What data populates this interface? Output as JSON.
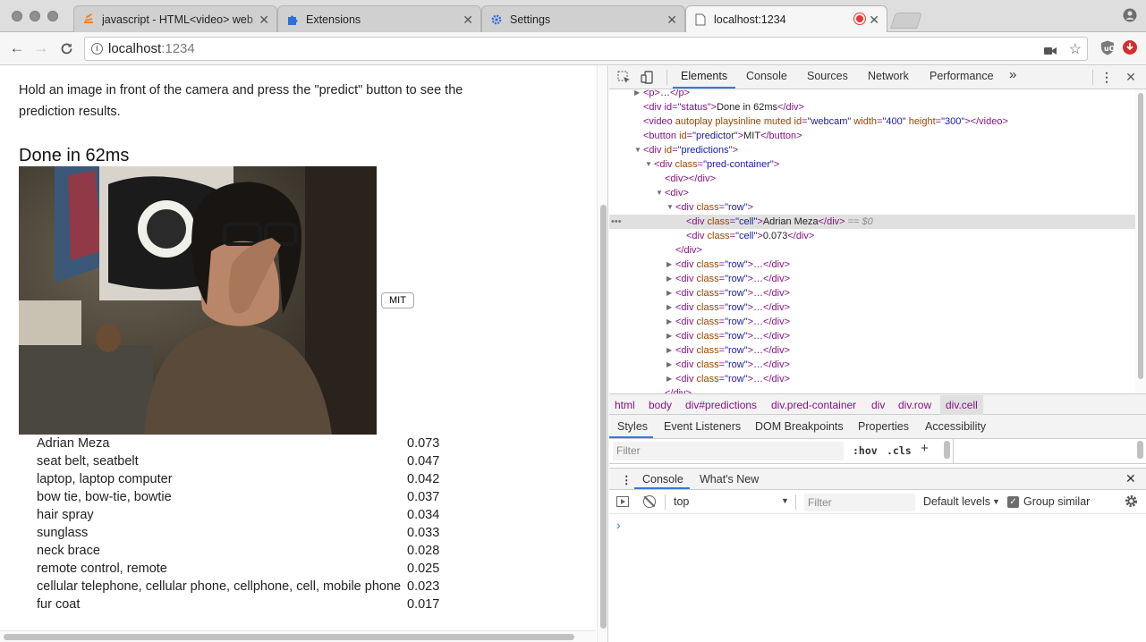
{
  "browser": {
    "tabs": [
      {
        "title": "javascript - HTML<video> web",
        "icon": "stackoverflow-icon",
        "active": false
      },
      {
        "title": "Extensions",
        "icon": "puzzle-icon",
        "active": false
      },
      {
        "title": "Settings",
        "icon": "gear-icon",
        "active": false
      },
      {
        "title": "localhost:1234",
        "icon": "page-icon",
        "active": true
      }
    ],
    "url_host": "localhost",
    "url_port": ":1234",
    "colors": {
      "tab_strip": "#dedede",
      "toolbar": "#f6f6f6",
      "accent": "#3879d9",
      "record": "#e53935"
    }
  },
  "page": {
    "intro": "Hold an image in front of the camera and press the \"predict\" button to see the prediction results.",
    "status": "Done in 62ms",
    "predict_button": "MIT",
    "predictions": [
      {
        "label": "Adrian Meza",
        "value": "0.073"
      },
      {
        "label": "seat belt, seatbelt",
        "value": "0.047"
      },
      {
        "label": "laptop, laptop computer",
        "value": "0.042"
      },
      {
        "label": "bow tie, bow-tie, bowtie",
        "value": "0.037"
      },
      {
        "label": "hair spray",
        "value": "0.034"
      },
      {
        "label": "sunglass",
        "value": "0.033"
      },
      {
        "label": "neck brace",
        "value": "0.028"
      },
      {
        "label": "remote control, remote",
        "value": "0.025"
      },
      {
        "label": "cellular telephone, cellular phone, cellphone, cell, mobile phone",
        "value": "0.023"
      },
      {
        "label": "fur coat",
        "value": "0.017"
      }
    ]
  },
  "devtools": {
    "tabs": [
      "Elements",
      "Console",
      "Sources",
      "Network",
      "Performance"
    ],
    "more": "»",
    "dom": {
      "p_open": "<p>",
      "p_ellipsis": "…",
      "p_close": "</p>",
      "status_open": "<div id=\"status\">",
      "status_text": "Done in 62ms",
      "status_close": "</div>",
      "video_line": "<video autoplay playsinline muted id=\"webcam\" width=\"400\" height=\"300\"></video>",
      "video_tag": "<video",
      "video_attrs": " autoplay playsinline muted",
      "video_id_an": " id",
      "video_id_av": "\"webcam\"",
      "video_w_an": " width",
      "video_w_av": "\"400\"",
      "video_h_an": " height",
      "video_h_av": "\"300\"",
      "video_end": "></video>",
      "button_tag": "<button",
      "button_an": " id",
      "button_av": "\"predictor\"",
      "button_text": "MIT",
      "button_close": "</button>",
      "preds_tag": "<div",
      "preds_an": " id",
      "preds_av": "\"predictions\"",
      "gt": ">",
      "pc_tag": "<div",
      "pc_an": " class",
      "pc_av": "\"pred-container\"",
      "empty_div": "<div></div>",
      "div_open": "<div>",
      "row_tag": "<div",
      "row_an": " class",
      "row_av": "\"row\"",
      "cell_tag": "<div",
      "cell_an": " class",
      "cell_av": "\"cell\"",
      "cell1_text": "Adrian Meza",
      "cell2_text": "0.073",
      "div_close": "</div>",
      "eq_marker": " == $0",
      "collapsed_row_end": "…</div>",
      "last_partial": "</div>"
    },
    "breadcrumbs": [
      "html",
      "body",
      "div#predictions",
      "div.pred-container",
      "div",
      "div.row",
      "div.cell"
    ],
    "style_tabs": [
      "Styles",
      "Event Listeners",
      "DOM Breakpoints",
      "Properties",
      "Accessibility"
    ],
    "filter_placeholder": "Filter",
    "hov": ":hov",
    "cls": ".cls",
    "plus": "+",
    "drawer_tabs": [
      "Console",
      "What's New"
    ],
    "context": "top",
    "console_filter": "Filter",
    "levels": "Default levels",
    "group_similar": "Group similar",
    "prompt": "›"
  }
}
